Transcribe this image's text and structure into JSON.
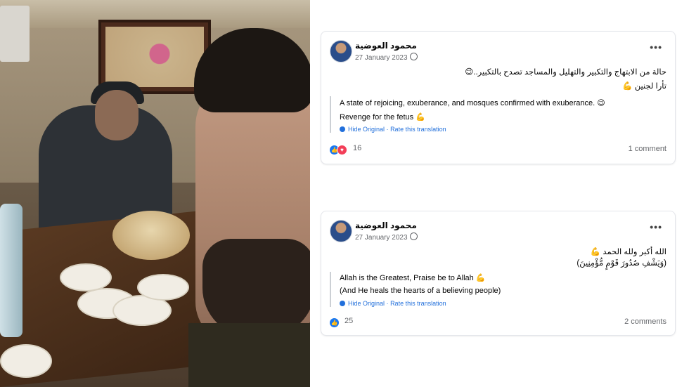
{
  "posts": [
    {
      "author": "محمود العوضية",
      "date": "27 January 2023",
      "text_ar_line1": "حالة من الابتهاج والتكبير والتهليل والمساجد تصدح بالتكبير..😉",
      "text_ar_line2": "تأرا لجنين 💪",
      "translation_line1": "A state of rejoicing, exuberance, and mosques confirmed with exuberance. 😉",
      "translation_line2": "Revenge for the fetus 💪",
      "hide_original": "Hide Original",
      "separator": "·",
      "rate_translation": "Rate this translation",
      "reactions_count": "16",
      "comments_count": "1 comment"
    },
    {
      "author": "محمود العوضية",
      "date": "27 January 2023",
      "text_ar_line1": "الله أكبر ولله الحمد 💪",
      "text_ar_line2": "(وَيَشْفِ صُدُورَ قَوْمٍ مُّؤْمِنِينَ)",
      "translation_line1": "Allah is the Greatest, Praise be to Allah 💪",
      "translation_line2": "(And He heals the hearts of a believing people)",
      "hide_original": "Hide Original",
      "separator": "·",
      "rate_translation": "Rate this translation",
      "reactions_count": "25",
      "comments_count": "2 comments"
    }
  ],
  "colors": {
    "link_blue": "#216fdb",
    "like_blue": "#1877f2",
    "love_red": "#f33e58",
    "meta_gray": "#65676b"
  },
  "icons": [
    "globe-icon",
    "more-options-icon",
    "translate-gear-icon",
    "like-reaction-icon",
    "love-reaction-icon"
  ]
}
